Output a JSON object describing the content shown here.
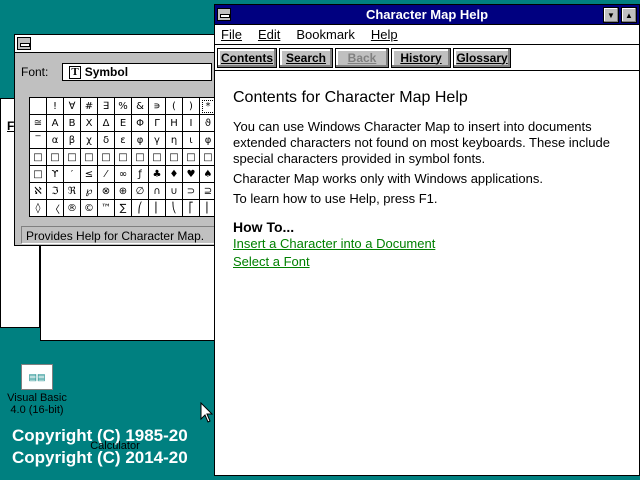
{
  "desktop": {
    "copyright_lines": [
      "Copyright (C) 1985-20",
      "Copyright (C) 2014-20"
    ],
    "icons": [
      {
        "label": "Visual Basic 4.0 (16-bit)",
        "icon": "visual-basic-icon"
      },
      {
        "label": "Calculator",
        "icon": "calculator-icon"
      }
    ],
    "partial_menu_letter": "F"
  },
  "charmap": {
    "font_label": "Font:",
    "font_value": "Symbol",
    "status_text": "Provides Help for Character Map.",
    "grid": [
      [
        " ",
        "!",
        "∀",
        "#",
        "∃",
        "%",
        "&",
        "∍",
        "(",
        ")",
        "*"
      ],
      [
        "≅",
        "Α",
        "Β",
        "Χ",
        "Δ",
        "Ε",
        "Φ",
        "Γ",
        "Η",
        "Ι",
        "ϑ"
      ],
      [
        "‾",
        "α",
        "β",
        "χ",
        "δ",
        "ε",
        "φ",
        "γ",
        "η",
        "ι",
        "φ"
      ],
      [
        "□",
        "□",
        "□",
        "□",
        "□",
        "□",
        "□",
        "□",
        "□",
        "□",
        "□"
      ],
      [
        "□",
        "ϒ",
        "′",
        "≤",
        "⁄",
        "∞",
        "ƒ",
        "♣",
        "♦",
        "♥",
        "♠"
      ],
      [
        "ℵ",
        "ℑ",
        "ℜ",
        "℘",
        "⊗",
        "⊕",
        "∅",
        "∩",
        "∪",
        "⊃",
        "⊇"
      ],
      [
        "◊",
        "〈",
        "®",
        "©",
        "™",
        "∑",
        "⎛",
        "⎜",
        "⎝",
        "⎡",
        "⎢"
      ]
    ],
    "selected_char": "*"
  },
  "help": {
    "title": "Character Map Help",
    "menu": [
      "File",
      "Edit",
      "Bookmark",
      "Help"
    ],
    "buttons": [
      {
        "label": "Contents",
        "enabled": true
      },
      {
        "label": "Search",
        "enabled": true
      },
      {
        "label": "Back",
        "enabled": false
      },
      {
        "label": "History",
        "enabled": true
      },
      {
        "label": "Glossary",
        "enabled": true
      }
    ],
    "heading": "Contents for Character Map Help",
    "paragraphs": [
      "You can use Windows Character Map to insert into documents extended characters not found on most keyboards. These include special characters provided in symbol fonts.",
      "Character Map works only with Windows applications.",
      "To learn how to use Help, press F1."
    ],
    "howto_heading": "How To...",
    "links": [
      "Insert a Character into a Document",
      "Select a Font"
    ]
  },
  "colors": {
    "desktop": "#008080",
    "titlebar_active": "#000080",
    "link": "#008000",
    "face": "#c0c0c0"
  }
}
